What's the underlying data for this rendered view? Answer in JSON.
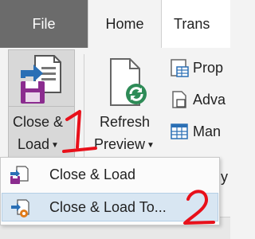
{
  "tabs": {
    "file": "File",
    "home": "Home",
    "transform": "Trans"
  },
  "ribbon": {
    "close_load": {
      "line1": "Close &",
      "line2": "Load",
      "icon": "close-and-load-icon"
    },
    "refresh_preview": {
      "line1": "Refresh",
      "line2": "Preview",
      "icon": "refresh-preview-icon"
    },
    "small_buttons": [
      {
        "label": "Prop",
        "icon": "properties-icon"
      },
      {
        "label": "Adva",
        "icon": "advanced-editor-icon"
      },
      {
        "label": "Man",
        "icon": "manage-icon"
      }
    ],
    "partial_text": "y"
  },
  "menu": {
    "items": [
      {
        "label": "Close & Load",
        "icon": "close-and-load-icon"
      },
      {
        "label": "Close & Load To...",
        "icon": "close-and-load-to-icon"
      }
    ]
  },
  "annotations": {
    "one": "1",
    "two": "2",
    "color": "#e8101a"
  },
  "colors": {
    "file_tab": "#6b6b6b",
    "menu_highlight": "#d8e6f2",
    "disk_purple": "#8b2c8f",
    "refresh_green": "#2e8b57"
  }
}
